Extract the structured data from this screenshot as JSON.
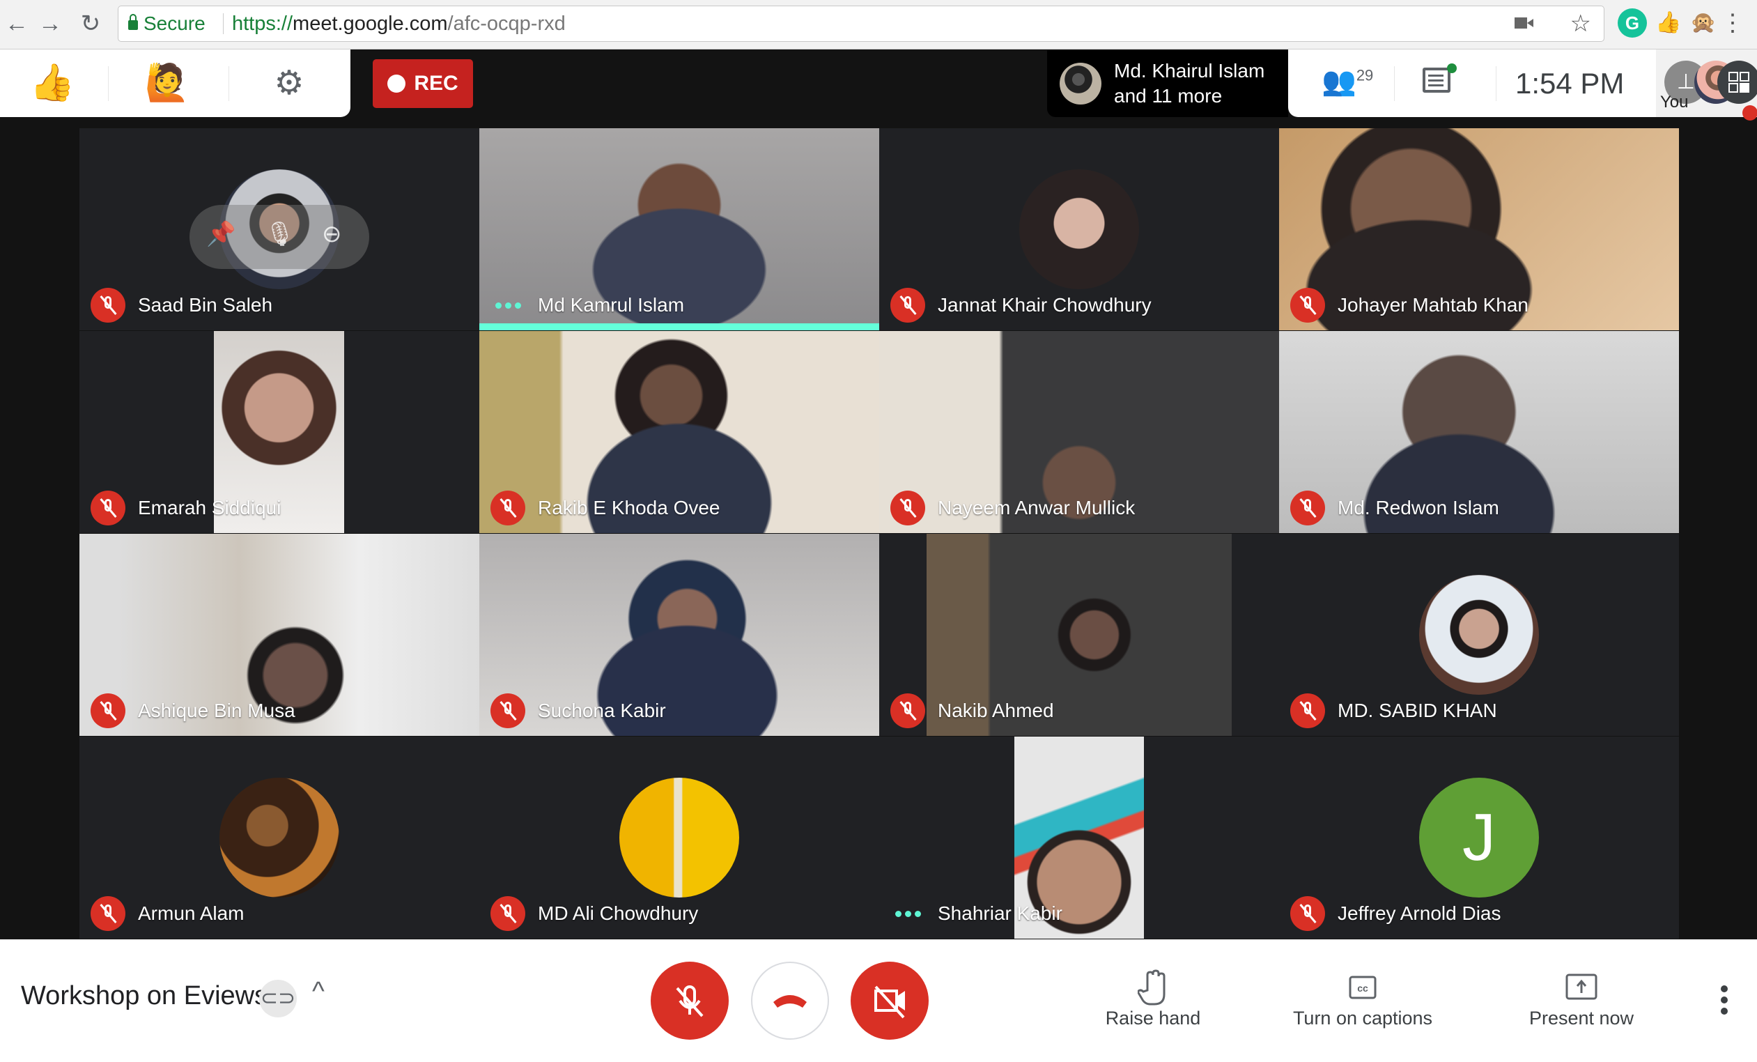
{
  "browser": {
    "back_icon": "arrow-left-icon",
    "forward_icon": "arrow-right-icon",
    "reload_icon": "reload-icon",
    "secure_label": "Secure",
    "url_scheme": "https://",
    "url_host": "meet.google.com",
    "url_path": "/afc-ocqp-rxd",
    "extensions": [
      "camera-icon",
      "star-icon",
      "grammarly-icon",
      "thumbs-up-icon",
      "monkey-icon",
      "menu-icon"
    ],
    "grammarly_letter": "G"
  },
  "toolbar": {
    "thumbs_up_emoji": "👍",
    "raise_hand_emoji": "🙋",
    "settings_icon": "⚙",
    "rec_label": "REC"
  },
  "presenting": {
    "line1": "Md. Khairul Islam",
    "line2": "and 11 more"
  },
  "header_right": {
    "people_count": "29",
    "people_icon": "👥",
    "chat_has_unread": true,
    "time": "1:54  PM",
    "self_label": "You",
    "pin_icon": "📌"
  },
  "participants": [
    {
      "name": "Saad Bin Saleh",
      "state": "muted",
      "view": "avatar",
      "hover_controls": true
    },
    {
      "name": "Md Kamrul Islam",
      "state": "speaking",
      "view": "video",
      "active": true
    },
    {
      "name": "Jannat Khair Chowdhury",
      "state": "muted",
      "view": "avatar"
    },
    {
      "name": "Johayer Mahtab Khan",
      "state": "muted",
      "view": "video"
    },
    {
      "name": "Emarah Siddiqui",
      "state": "muted",
      "view": "video"
    },
    {
      "name": "Rakib E Khoda Ovee",
      "state": "muted",
      "view": "video"
    },
    {
      "name": "Nayeem Anwar Mullick",
      "state": "muted",
      "view": "video"
    },
    {
      "name": "Md. Redwon Islam",
      "state": "muted",
      "view": "video"
    },
    {
      "name": "Ashique Bin Musa",
      "state": "muted",
      "view": "video"
    },
    {
      "name": "Suchona Kabir",
      "state": "muted",
      "view": "video"
    },
    {
      "name": "Nakib Ahmed",
      "state": "muted",
      "view": "video"
    },
    {
      "name": "MD. SABID KHAN",
      "state": "muted",
      "view": "avatar"
    },
    {
      "name": "Armun Alam",
      "state": "muted",
      "view": "avatar"
    },
    {
      "name": "MD Ali Chowdhury",
      "state": "muted",
      "view": "avatar"
    },
    {
      "name": "Shahriar Kabir",
      "state": "speaking",
      "view": "video"
    },
    {
      "name": "Jeffrey Arnold Dias",
      "state": "muted",
      "view": "initial",
      "initial": "J",
      "color": "#5f9f35"
    }
  ],
  "bottom_bar": {
    "meeting_title": "Workshop on Eviews",
    "mic_state": "muted",
    "camera_state": "off",
    "actions": [
      {
        "label": "Raise hand",
        "icon": "hand-icon"
      },
      {
        "label": "Turn on captions",
        "icon": "captions-icon"
      },
      {
        "label": "Present now",
        "icon": "present-icon"
      }
    ]
  },
  "colors": {
    "accent_red": "#d93025",
    "rec_red": "#c5221f",
    "speaking_teal": "#64ffda",
    "tile_bg": "#202124",
    "page_bg": "#131313"
  }
}
